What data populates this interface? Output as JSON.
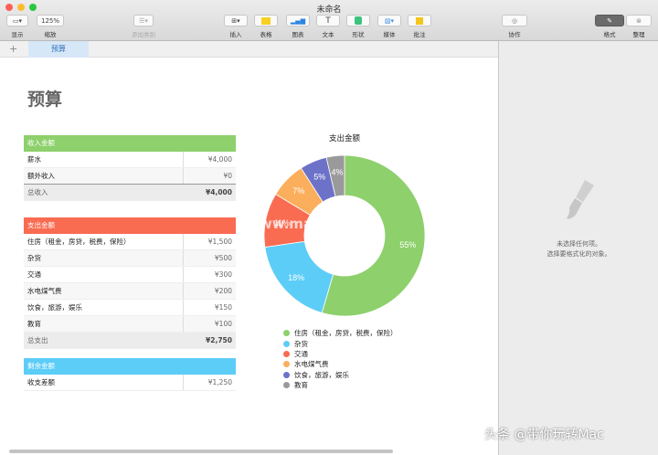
{
  "window": {
    "title": "未命名"
  },
  "toolbar": {
    "view": "显示",
    "zoom_value": "125%",
    "zoom": "缩放",
    "add_category": "添加类别",
    "insert": "插入",
    "table": "表格",
    "chart": "图表",
    "text": "文本",
    "shape": "形状",
    "media": "媒体",
    "comment": "批注",
    "collaborate": "协作",
    "format": "格式",
    "organize": "整理"
  },
  "tabs": [
    {
      "label": "预算"
    }
  ],
  "sheet_title": "预算",
  "income": {
    "header": "收入金额",
    "rows": [
      {
        "label": "薪水",
        "value": "¥4,000"
      },
      {
        "label": "额外收入",
        "value": "¥0"
      }
    ],
    "total_label": "总收入",
    "total": "¥4,000"
  },
  "expense": {
    "header": "支出金额",
    "rows": [
      {
        "label": "住房（租金，房贷，税费，保险）",
        "value": "¥1,500"
      },
      {
        "label": "杂货",
        "value": "¥500"
      },
      {
        "label": "交通",
        "value": "¥300"
      },
      {
        "label": "水电煤气费",
        "value": "¥200"
      },
      {
        "label": "饮食，旅游，娱乐",
        "value": "¥150"
      },
      {
        "label": "教育",
        "value": "¥100"
      }
    ],
    "total_label": "总支出",
    "total": "¥2,750"
  },
  "remaining": {
    "header": "剩余金额",
    "rows": [
      {
        "label": "收支差额",
        "value": "¥1,250"
      }
    ]
  },
  "colors": {
    "income": "#8dd06c",
    "expense": "#f96c52",
    "remaining": "#5ccdf7"
  },
  "chart_data": {
    "type": "pie",
    "title": "支出金额",
    "categories": [
      "住房（租金，房贷，税费，保险）",
      "杂货",
      "交通",
      "水电煤气费",
      "饮食，旅游，娱乐",
      "教育"
    ],
    "values": [
      1500,
      500,
      300,
      200,
      150,
      100
    ],
    "labels": [
      "55%",
      "18%",
      "11%",
      "7%",
      "5%",
      "4%"
    ],
    "colors": [
      "#8dd06c",
      "#5ccdf7",
      "#f96c52",
      "#fbae5c",
      "#6c72c8",
      "#9a9a9a"
    ],
    "donut": true,
    "legend": "bottom"
  },
  "sidebar": {
    "line1": "未选择任何项。",
    "line2": "选择要格式化的对象。"
  },
  "watermarks": {
    "chart": "www.macjb.com",
    "corner": "头条 @带你玩转Mac"
  }
}
